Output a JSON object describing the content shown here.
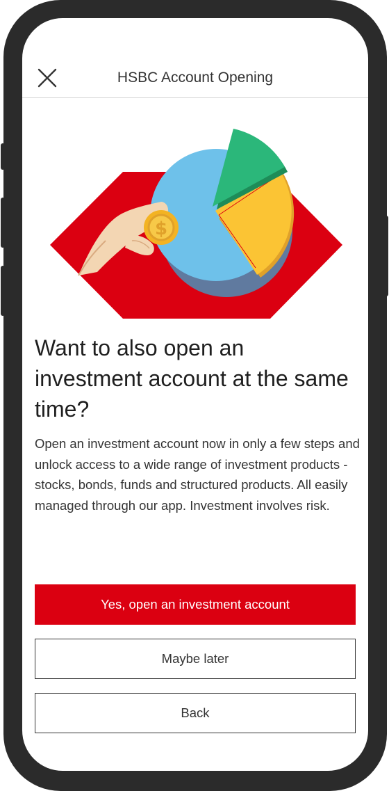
{
  "header": {
    "title": "HSBC Account Opening",
    "close_icon": "close-icon"
  },
  "hero": {
    "illustration": "hand-holding-coin-pie-chart",
    "coin_symbol": "$"
  },
  "content": {
    "headline": "Want to also open an investment account at the same time?",
    "body": "Open an investment account now in only a few steps and unlock access to a wide range of investment products - stocks, bonds, funds and structured products. All easily managed through our app. Investment involves risk."
  },
  "actions": {
    "primary_label": "Yes, open an investment account",
    "later_label": "Maybe later",
    "back_label": "Back"
  },
  "colors": {
    "brand_red": "#db0011",
    "text_dark": "#333333",
    "pie_blue": "#6ec1ea",
    "pie_yellow": "#fbc434",
    "pie_green": "#2bb77a",
    "coin_gold": "#f3b323"
  }
}
